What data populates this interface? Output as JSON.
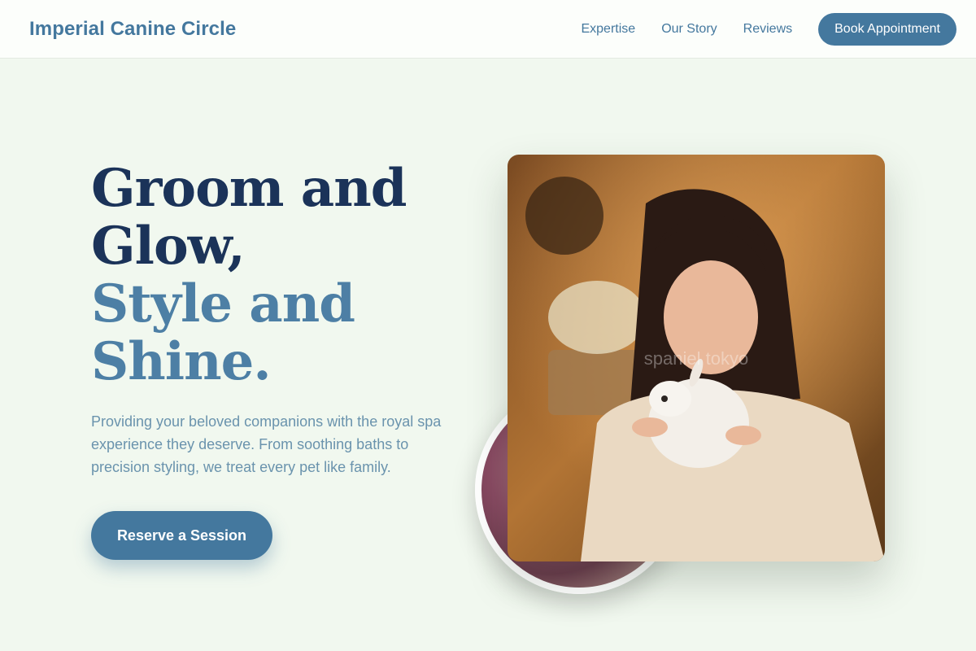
{
  "header": {
    "brand": "Imperial Canine Circle",
    "nav": [
      "Expertise",
      "Our Story",
      "Reviews"
    ],
    "cta": "Book Appointment"
  },
  "hero": {
    "title_line1": "Groom and",
    "title_line2": "Glow,",
    "title_line3": "Style and",
    "title_line4": "Shine.",
    "description": "Providing your beloved companions with the royal spa experience they deserve. From soothing baths to precision styling, we treat every pet like family.",
    "cta": "Reserve a Session"
  },
  "images": {
    "main_watermark": "spaniel tokyo"
  },
  "colors": {
    "accent": "#44789e",
    "title_dark": "#1b3359",
    "title_light": "#4d7fa5",
    "background": "#f1f8ef"
  }
}
